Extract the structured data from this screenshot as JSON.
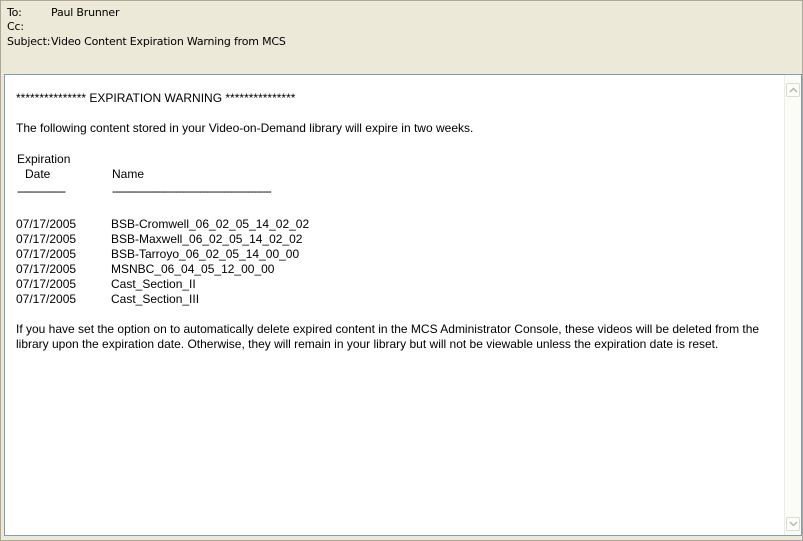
{
  "header": {
    "to_label": "To:",
    "to_value": "Paul Brunner",
    "cc_label": "Cc:",
    "cc_value": "",
    "subject_label": "Subject:",
    "subject_value": "Video Content Expiration Warning from MCS"
  },
  "message": {
    "warning_line": "*************** EXPIRATION WARNING ***************",
    "intro": "The following content stored in your Video-on-Demand library will expire in two weeks.",
    "table": {
      "header_date_line1": "Expiration",
      "header_date_line2": "Date",
      "header_name": "Name",
      "date_divider": "----------------",
      "name_divider": "-----------------------------------------------------",
      "rows": [
        {
          "date": "07/17/2005",
          "name": "BSB-Cromwell_06_02_05_14_02_02"
        },
        {
          "date": "07/17/2005",
          "name": "BSB-Maxwell_06_02_05_14_02_02"
        },
        {
          "date": "07/17/2005",
          "name": "BSB-Tarroyo_06_02_05_14_00_00"
        },
        {
          "date": "07/17/2005",
          "name": "MSNBC_06_04_05_12_00_00"
        },
        {
          "date": "07/17/2005",
          "name": "Cast_Section_II"
        },
        {
          "date": "07/17/2005",
          "name": "Cast_Section_III"
        }
      ]
    },
    "closing": "If you have set the option on to automatically delete expired content in the MCS Administrator Console, these videos will be deleted from the library upon the expiration date. Otherwise, they will remain in your library but will not be viewable unless the expiration date is reset."
  },
  "icons": {
    "scroll_up": "chevron-up-icon",
    "scroll_down": "chevron-down-icon"
  },
  "colors": {
    "window_bg": "#ece9d8",
    "body_bg": "#ffffff",
    "frame_border": "#7f9db9"
  }
}
